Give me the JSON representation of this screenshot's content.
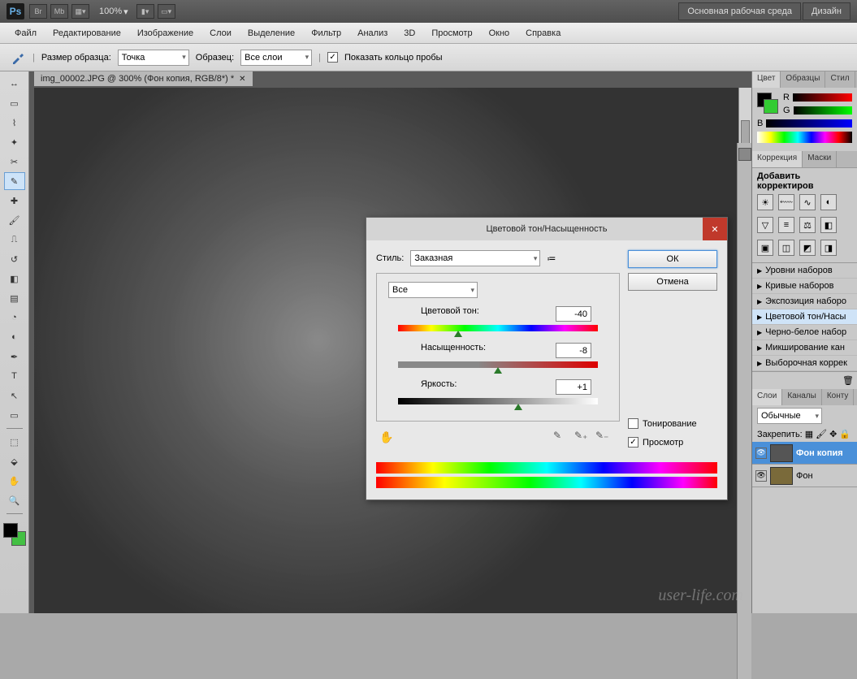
{
  "top": {
    "zoom": "100%",
    "btn_workspace": "Основная рабочая среда",
    "btn_design": "Дизайн"
  },
  "menu": [
    "Файл",
    "Редактирование",
    "Изображение",
    "Слои",
    "Выделение",
    "Фильтр",
    "Анализ",
    "3D",
    "Просмотр",
    "Окно",
    "Справка"
  ],
  "options": {
    "sample_size_label": "Размер образца:",
    "sample_size_value": "Точка",
    "sample_label": "Образец:",
    "sample_value": "Все слои",
    "show_ring": "Показать кольцо пробы"
  },
  "doc_tab": "img_00002.JPG @ 300% (Фон копия, RGB/8*) *",
  "panels": {
    "color_tabs": [
      "Цвет",
      "Образцы",
      "Стил"
    ],
    "rgb": [
      "R",
      "G",
      "B"
    ],
    "correction_tabs": [
      "Коррекция",
      "Маски"
    ],
    "correction_add": "Добавить корректиров",
    "adj_presets": [
      "Уровни наборов",
      "Кривые наборов",
      "Экспозиция наборо",
      "Цветовой тон/Насы",
      "Черно-белое набор",
      "Микширование кан",
      "Выборочная коррек"
    ],
    "layers_tabs": [
      "Слои",
      "Каналы",
      "Конту"
    ],
    "blend_mode": "Обычные",
    "lock_label": "Закрепить:",
    "layers": [
      {
        "name": "Фон копия",
        "active": true
      },
      {
        "name": "Фон",
        "active": false
      }
    ]
  },
  "dialog": {
    "title": "Цветовой тон/Насыщенность",
    "style_label": "Стиль:",
    "style_value": "Заказная",
    "range_value": "Все",
    "hue_label": "Цветовой тон:",
    "hue_value": "-40",
    "sat_label": "Насыщенность:",
    "sat_value": "-8",
    "lig_label": "Яркость:",
    "lig_value": "+1",
    "ok": "ОК",
    "cancel": "Отмена",
    "colorize": "Тонирование",
    "preview": "Просмотр"
  },
  "watermark": "user-life.com"
}
